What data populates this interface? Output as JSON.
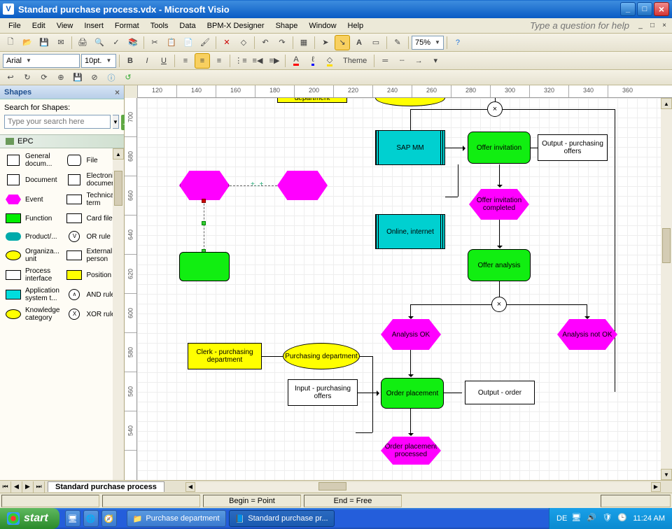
{
  "titlebar": {
    "title": "Standard purchase process.vdx - Microsoft Visio"
  },
  "menubar": {
    "items": [
      "File",
      "Edit",
      "View",
      "Insert",
      "Format",
      "Tools",
      "Data",
      "BPM-X Designer",
      "Shape",
      "Window",
      "Help"
    ],
    "qa_placeholder": "Type a question for help"
  },
  "toolbar1": {
    "zoom": "75%"
  },
  "toolbar2": {
    "font": "Arial",
    "size": "10pt.",
    "theme": "Theme"
  },
  "shapes": {
    "header": "Shapes",
    "search_label": "Search for Shapes:",
    "search_placeholder": "Type your search here",
    "stencil": "EPC",
    "items": [
      {
        "label": "General docum...",
        "icon": "i-doc"
      },
      {
        "label": "File",
        "icon": "i-cyl"
      },
      {
        "label": "Document",
        "icon": "i-doc"
      },
      {
        "label": "Electronic document",
        "icon": "i-doc"
      },
      {
        "label": "Event",
        "icon": "i-hex"
      },
      {
        "label": "Technical term",
        "icon": "i-rect-w"
      },
      {
        "label": "Function",
        "icon": "i-rect-g"
      },
      {
        "label": "Card file",
        "icon": "i-rect-w"
      },
      {
        "label": "Product/...",
        "icon": "i-cloud"
      },
      {
        "label": "OR rule",
        "icon": "i-circ",
        "sym": "V"
      },
      {
        "label": "Organiza... unit",
        "icon": "i-oval"
      },
      {
        "label": "External person",
        "icon": "i-rect-w"
      },
      {
        "label": "Process interface",
        "icon": "i-rect-w"
      },
      {
        "label": "Position",
        "icon": "i-rect-y"
      },
      {
        "label": "Application system t...",
        "icon": "i-app"
      },
      {
        "label": "AND rule",
        "icon": "i-circ",
        "sym": "∧"
      },
      {
        "label": "Knowledge category",
        "icon": "i-oval"
      },
      {
        "label": "XOR rule",
        "icon": "i-circ",
        "sym": "X"
      }
    ]
  },
  "ruler_h": [
    "120",
    "140",
    "160",
    "180",
    "200",
    "220",
    "240",
    "260",
    "280",
    "300",
    "320",
    "340",
    "360"
  ],
  "ruler_v": [
    "700",
    "680",
    "660",
    "640",
    "620",
    "600",
    "580",
    "560",
    "540"
  ],
  "canvas": {
    "dept_top": "department",
    "sap1": "SAP MM",
    "offer_inv": "Offer invitation",
    "output_offers": "Output - purchasing offers",
    "online": "Online, internet",
    "offer_inv_comp": "Offer invitation completed",
    "offer_analysis": "Offer analysis",
    "analysis_ok": "Analysis OK",
    "analysis_nok": "Analysis not OK",
    "clerk": "Clerk - purchasing department",
    "purch_dept": "Purchasing department",
    "input_offers": "Input - purchasing offers",
    "order_place": "Order placement",
    "output_order": "Output - order",
    "sap2": "SAP MM",
    "order_proc": "Order placement processed",
    "gate": "×"
  },
  "pagetab": "Standard purchase process",
  "statusbar": {
    "begin": "Begin = Point",
    "end": "End = Free"
  },
  "taskbar": {
    "start": "start",
    "btn1": "Purchase department",
    "btn2": "Standard purchase pr...",
    "lang": "DE",
    "time": "11:24 AM"
  }
}
